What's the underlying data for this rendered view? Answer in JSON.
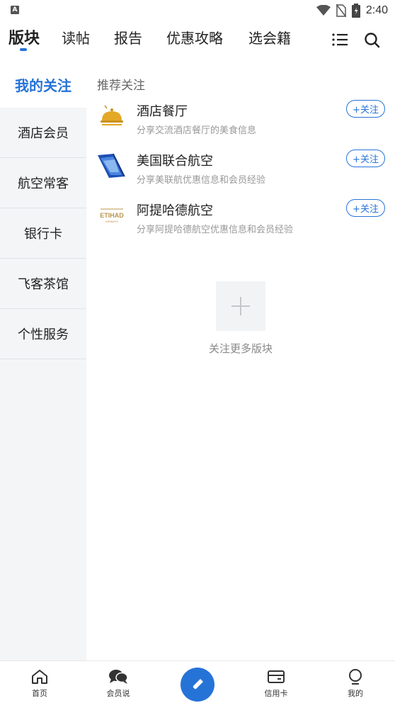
{
  "status_bar": {
    "left_badge": "A",
    "time": "2:40",
    "icons": [
      "wifi-icon",
      "no-sim-icon",
      "battery-icon"
    ]
  },
  "top_nav": {
    "tabs": [
      {
        "label": "版块",
        "active": true
      },
      {
        "label": "读帖",
        "active": false
      },
      {
        "label": "报告",
        "active": false
      },
      {
        "label": "优惠攻略",
        "active": false
      },
      {
        "label": "选会籍",
        "active": false
      }
    ],
    "icons": [
      "list-icon",
      "search-icon"
    ],
    "accent": "#2673d8"
  },
  "sidebar": {
    "items": [
      {
        "label": "我的关注",
        "active": true
      },
      {
        "label": "酒店会员",
        "active": false
      },
      {
        "label": "航空常客",
        "active": false
      },
      {
        "label": "银行卡",
        "active": false
      },
      {
        "label": "飞客茶馆",
        "active": false
      },
      {
        "label": "个性服务",
        "active": false
      }
    ]
  },
  "main": {
    "section_title": "推荐关注",
    "forums": [
      {
        "name": "酒店餐厅",
        "desc": "分享交流酒店餐厅的美食信息",
        "follow": "+关注",
        "logo": "cloche-icon"
      },
      {
        "name": "美国联合航空",
        "desc": "分享美联航优惠信息和会员经验",
        "follow": "+关注",
        "logo": "united-airlines-logo"
      },
      {
        "name": "阿提哈德航空",
        "desc": "分享阿提哈德航空优惠信息和会员经验",
        "follow": "+关注",
        "logo": "etihad-logo",
        "logo_text": "ETIHAD",
        "logo_subtext": "AIRWAYS"
      }
    ],
    "add_more": "关注更多版块"
  },
  "bottom_nav": {
    "items": [
      {
        "label": "首页",
        "icon": "home-icon"
      },
      {
        "label": "会员说",
        "icon": "chat-icon"
      },
      {
        "label": "",
        "icon": "compose-icon"
      },
      {
        "label": "信用卡",
        "icon": "credit-card-icon"
      },
      {
        "label": "我的",
        "icon": "profile-icon"
      }
    ]
  }
}
